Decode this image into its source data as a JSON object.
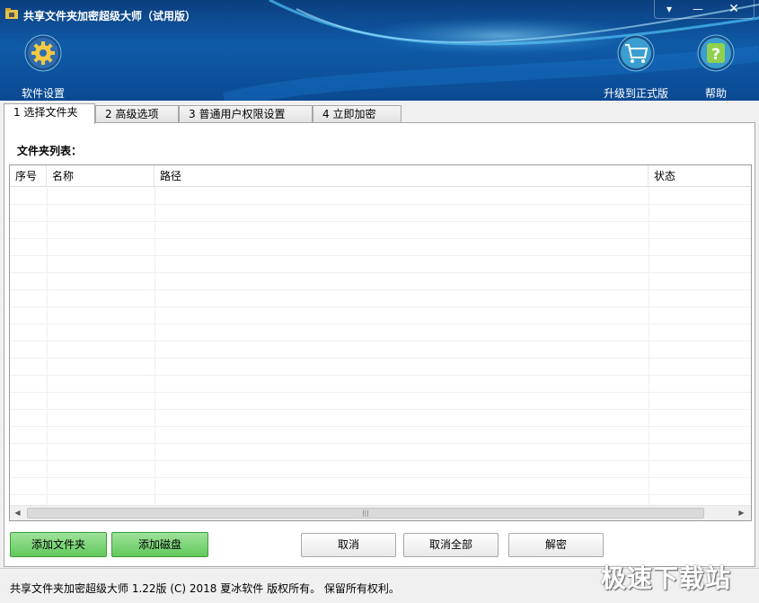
{
  "window": {
    "title": "共享文件夹加密超级大师（试用版）",
    "menu_glyph": "▾",
    "minimize_glyph": "—",
    "close_glyph": "✕"
  },
  "toolbar": {
    "settings_label": "软件设置",
    "upgrade_label": "升级到正式版",
    "help_label": "帮助"
  },
  "tabs": [
    {
      "label": "1 选择文件夹",
      "active": true
    },
    {
      "label": "2 高级选项",
      "active": false
    },
    {
      "label": "3 普通用户权限设置",
      "active": false
    },
    {
      "label": "4 立即加密",
      "active": false
    }
  ],
  "folder_list": {
    "title": "文件夹列表：",
    "columns": [
      "序号",
      "名称",
      "路径",
      "状态"
    ],
    "rows": []
  },
  "scrollbar": {
    "left_arrow": "◀",
    "right_arrow": "▶",
    "grip": "|||"
  },
  "buttons": {
    "add_folder": "添加文件夹",
    "add_disk": "添加磁盘",
    "cancel": "取消",
    "cancel_all": "取消全部",
    "decrypt": "解密"
  },
  "status_bar": {
    "text": "共享文件夹加密超级大师 1.22版 (C) 2018 夏冰软件 版权所有。 保留所有权利。"
  },
  "watermark": "极速下载站",
  "colors": {
    "header_blue": "#0f5aa8",
    "accent_green": "#62c95c",
    "icon_teal": "#35b7c9"
  },
  "icons": [
    "app-icon",
    "gear-icon",
    "shopping-cart-icon",
    "help-icon"
  ]
}
